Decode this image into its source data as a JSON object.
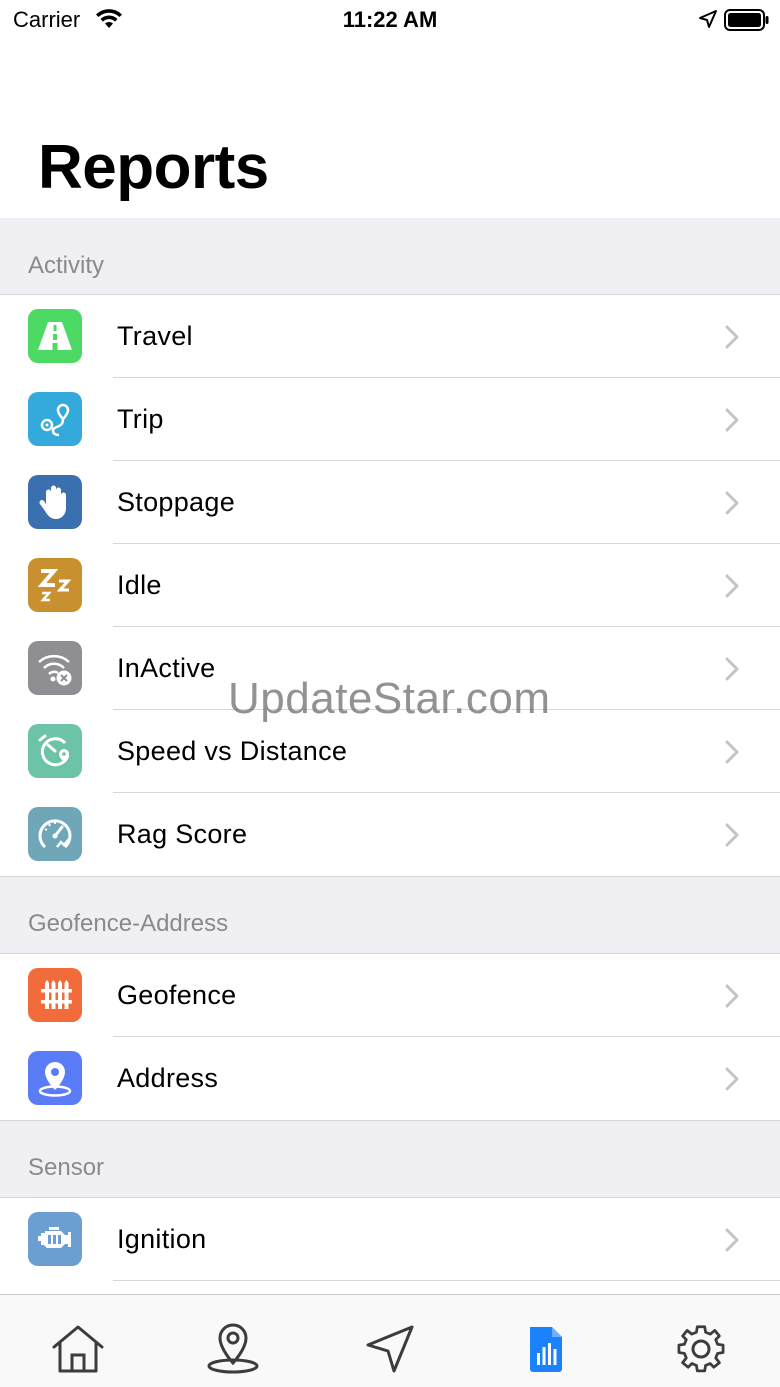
{
  "status_bar": {
    "carrier": "Carrier",
    "time": "11:22 AM"
  },
  "page": {
    "title": "Reports"
  },
  "sections": [
    {
      "header": "Activity",
      "items": [
        {
          "label": "Travel",
          "icon": "road-icon",
          "color": "#4cd964"
        },
        {
          "label": "Trip",
          "icon": "route-pin-icon",
          "color": "#34aadc"
        },
        {
          "label": "Stoppage",
          "icon": "hand-stop-icon",
          "color": "#3a6fb0"
        },
        {
          "label": "Idle",
          "icon": "sleep-zzz-icon",
          "color": "#c8902e"
        },
        {
          "label": "InActive",
          "icon": "wifi-off-icon",
          "color": "#8e8e93"
        },
        {
          "label": "Speed vs Distance",
          "icon": "speed-distance-icon",
          "color": "#6dc3a7"
        },
        {
          "label": "Rag Score",
          "icon": "gauge-icon",
          "color": "#6fa7b9"
        }
      ]
    },
    {
      "header": "Geofence-Address",
      "items": [
        {
          "label": "Geofence",
          "icon": "fence-icon",
          "color": "#f26b3a"
        },
        {
          "label": "Address",
          "icon": "map-pin-icon",
          "color": "#5b7cf7"
        }
      ]
    },
    {
      "header": "Sensor",
      "items": [
        {
          "label": "Ignition",
          "icon": "engine-icon",
          "color": "#6b9fd1"
        }
      ]
    }
  ],
  "watermark": "UpdateStar.com",
  "tab_bar": {
    "tabs": [
      "home-icon",
      "location-pin-icon",
      "navigation-arrow-icon",
      "reports-icon",
      "settings-gear-icon"
    ],
    "active_color": "#1a82fb",
    "inactive_color": "#3c3c3c"
  }
}
